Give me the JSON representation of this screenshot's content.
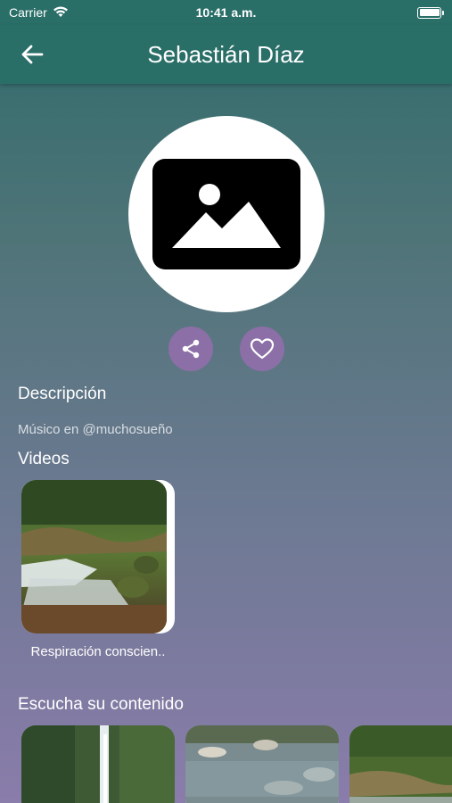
{
  "status_bar": {
    "carrier": "Carrier",
    "time": "10:41 a.m.",
    "icons": [
      "wifi-icon",
      "battery-icon"
    ]
  },
  "header": {
    "title": "Sebastián Díaz",
    "back_icon": "arrow-left-icon"
  },
  "profile": {
    "avatar_icon": "image-placeholder-icon",
    "actions": [
      {
        "icon": "share-icon"
      },
      {
        "icon": "heart-icon"
      }
    ]
  },
  "description": {
    "title": "Descripción",
    "text": "Músico en @muchosueño"
  },
  "videos": {
    "title": "Videos",
    "items": [
      {
        "label": "Respiración conscien.."
      }
    ]
  },
  "content": {
    "title": "Escucha su contenido"
  },
  "colors": {
    "app_bar": "#2a6e68",
    "action_button": "#8c6fa6",
    "gradient_top": "#2f6b6b",
    "gradient_bottom": "#8a7cab"
  }
}
